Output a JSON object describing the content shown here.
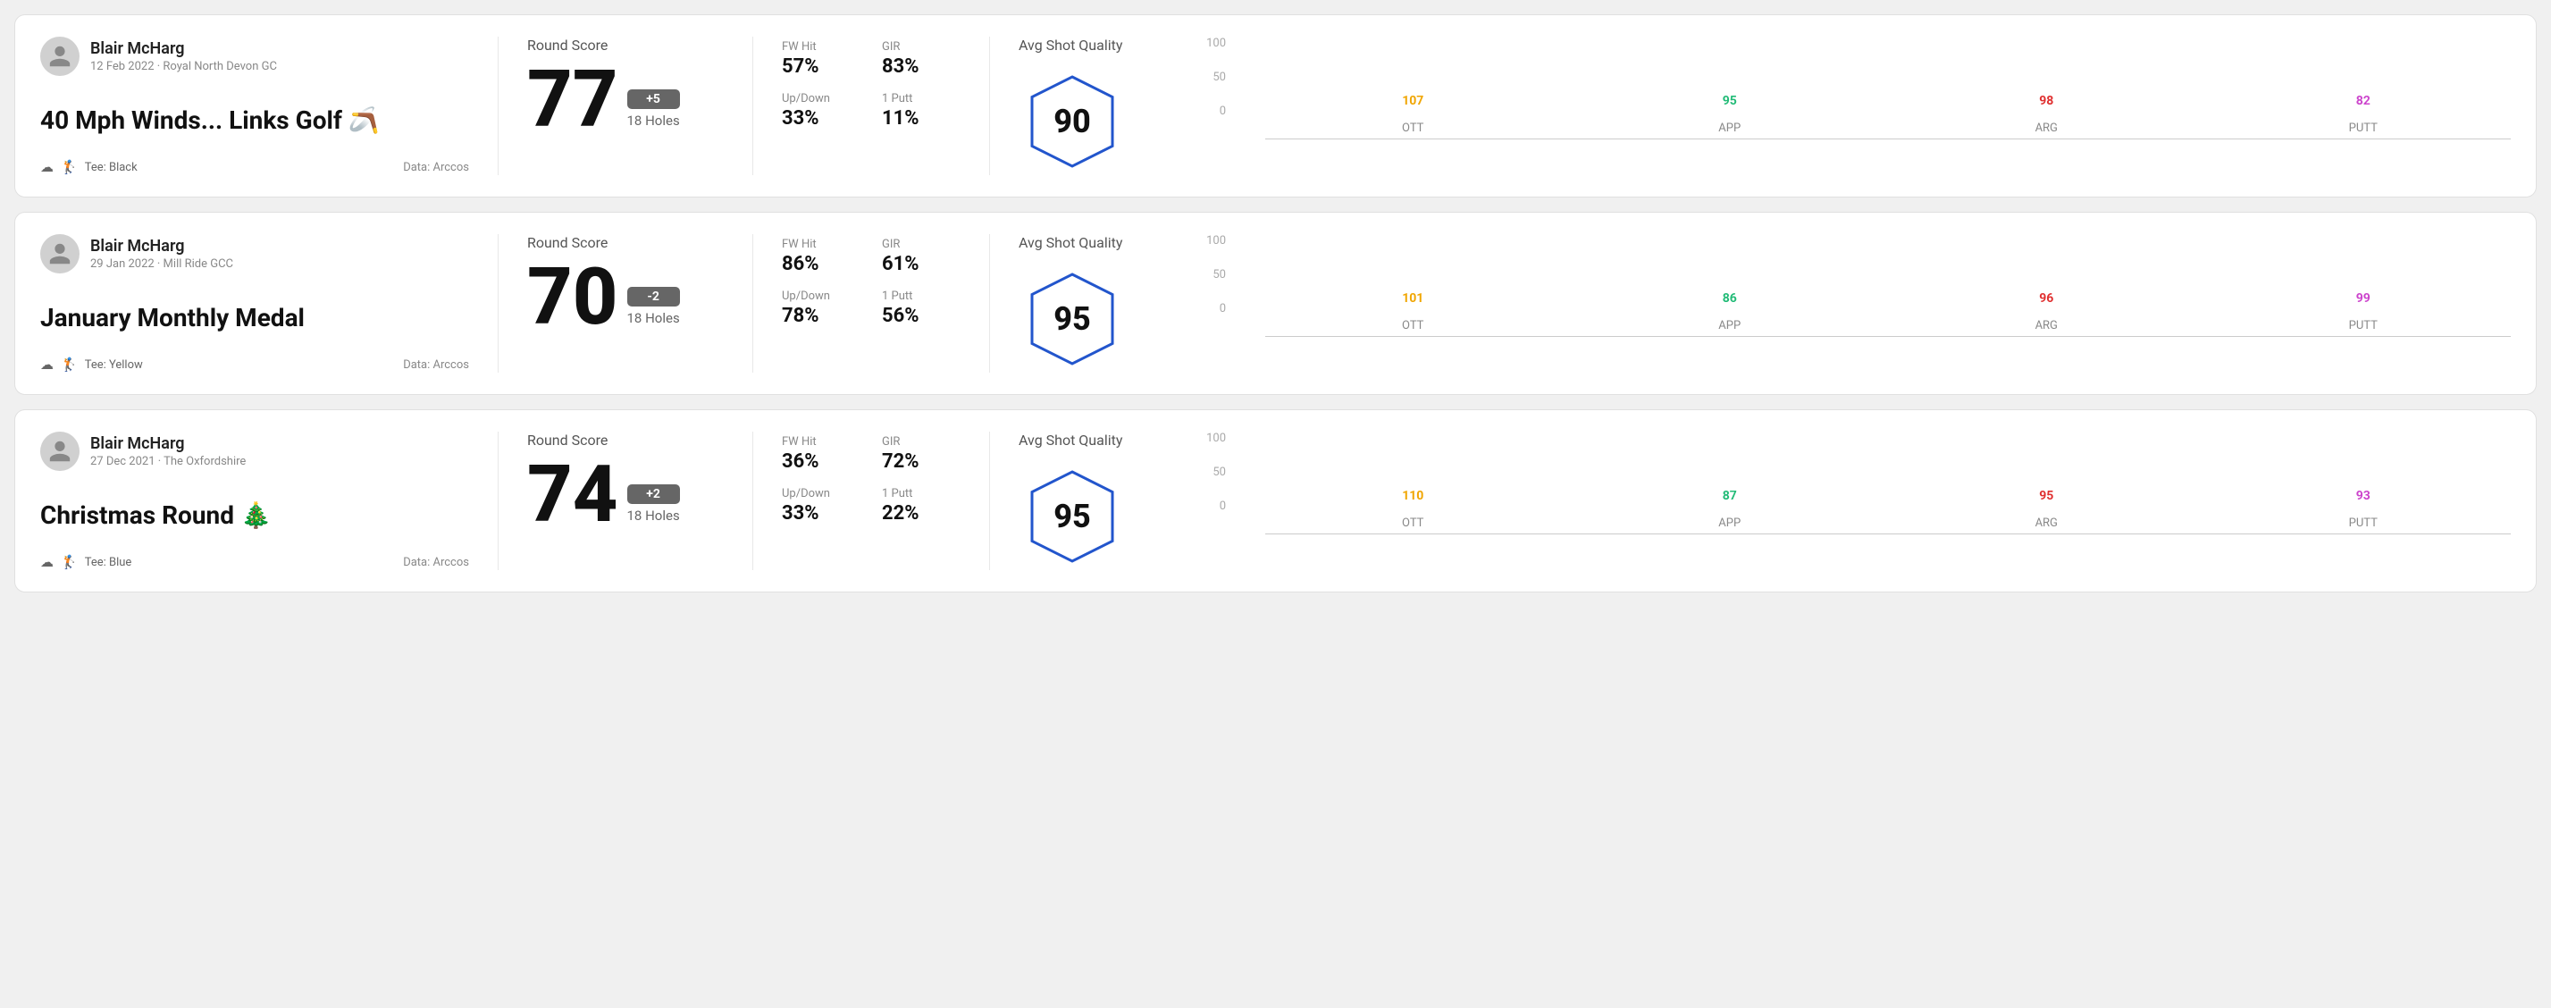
{
  "rounds": [
    {
      "user": "Blair McHarg",
      "date": "12 Feb 2022 · Royal North Devon GC",
      "title": "40 Mph Winds... Links Golf 🪃",
      "tee": "Black",
      "data_source": "Data: Arccos",
      "round_score_label": "Round Score",
      "score": "77",
      "badge": "+5",
      "badge_type": "plus",
      "holes": "18 Holes",
      "fw_hit_label": "FW Hit",
      "fw_hit": "57%",
      "gir_label": "GIR",
      "gir": "83%",
      "updown_label": "Up/Down",
      "updown": "33%",
      "oneputt_label": "1 Putt",
      "oneputt": "11%",
      "avg_quality_label": "Avg Shot Quality",
      "quality_score": "90",
      "chart": {
        "bars": [
          {
            "label": "OTT",
            "value": 107,
            "color_class": "color-ott",
            "line_class": "line-ott",
            "height_pct": 72
          },
          {
            "label": "APP",
            "value": 95,
            "color_class": "color-app",
            "line_class": "line-app",
            "height_pct": 64
          },
          {
            "label": "ARG",
            "value": 98,
            "color_class": "color-arg",
            "line_class": "line-arg",
            "height_pct": 66
          },
          {
            "label": "PUTT",
            "value": 82,
            "color_class": "color-putt",
            "line_class": "line-putt",
            "height_pct": 55
          }
        ]
      }
    },
    {
      "user": "Blair McHarg",
      "date": "29 Jan 2022 · Mill Ride GCC",
      "title": "January Monthly Medal",
      "tee": "Yellow",
      "data_source": "Data: Arccos",
      "round_score_label": "Round Score",
      "score": "70",
      "badge": "-2",
      "badge_type": "minus",
      "holes": "18 Holes",
      "fw_hit_label": "FW Hit",
      "fw_hit": "86%",
      "gir_label": "GIR",
      "gir": "61%",
      "updown_label": "Up/Down",
      "updown": "78%",
      "oneputt_label": "1 Putt",
      "oneputt": "56%",
      "avg_quality_label": "Avg Shot Quality",
      "quality_score": "95",
      "chart": {
        "bars": [
          {
            "label": "OTT",
            "value": 101,
            "color_class": "color-ott",
            "line_class": "line-ott",
            "height_pct": 68
          },
          {
            "label": "APP",
            "value": 86,
            "color_class": "color-app",
            "line_class": "line-app",
            "height_pct": 58
          },
          {
            "label": "ARG",
            "value": 96,
            "color_class": "color-arg",
            "line_class": "line-arg",
            "height_pct": 65
          },
          {
            "label": "PUTT",
            "value": 99,
            "color_class": "color-putt",
            "line_class": "line-putt",
            "height_pct": 67
          }
        ]
      }
    },
    {
      "user": "Blair McHarg",
      "date": "27 Dec 2021 · The Oxfordshire",
      "title": "Christmas Round 🎄",
      "tee": "Blue",
      "data_source": "Data: Arccos",
      "round_score_label": "Round Score",
      "score": "74",
      "badge": "+2",
      "badge_type": "plus",
      "holes": "18 Holes",
      "fw_hit_label": "FW Hit",
      "fw_hit": "36%",
      "gir_label": "GIR",
      "gir": "72%",
      "updown_label": "Up/Down",
      "updown": "33%",
      "oneputt_label": "1 Putt",
      "oneputt": "22%",
      "avg_quality_label": "Avg Shot Quality",
      "quality_score": "95",
      "chart": {
        "bars": [
          {
            "label": "OTT",
            "value": 110,
            "color_class": "color-ott",
            "line_class": "line-ott",
            "height_pct": 74
          },
          {
            "label": "APP",
            "value": 87,
            "color_class": "color-app",
            "line_class": "line-app",
            "height_pct": 58
          },
          {
            "label": "ARG",
            "value": 95,
            "color_class": "color-arg",
            "line_class": "line-arg",
            "height_pct": 64
          },
          {
            "label": "PUTT",
            "value": 93,
            "color_class": "color-putt",
            "line_class": "line-putt",
            "height_pct": 62
          }
        ]
      }
    }
  ],
  "chart_y_labels": [
    "100",
    "50",
    "0"
  ]
}
